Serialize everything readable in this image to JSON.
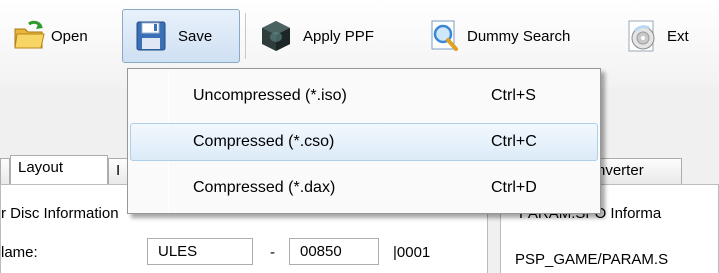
{
  "toolbar": {
    "open_label": "Open",
    "save_label": "Save",
    "apply_ppf_label": "Apply PPF",
    "dummy_search_label": "Dummy Search",
    "extract_label_partial": "Ext"
  },
  "save_menu": {
    "items": [
      {
        "label": "Uncompressed (*.iso)",
        "shortcut": "Ctrl+S"
      },
      {
        "label": "Compressed (*.cso)",
        "shortcut": "Ctrl+C"
      },
      {
        "label": "Compressed (*.dax)",
        "shortcut": "Ctrl+D"
      }
    ]
  },
  "tabs": {
    "layout": "Layout",
    "partial_hidden": "I",
    "converter_partial": "nverter"
  },
  "disc_info": {
    "group_title_partial": "r Disc Information",
    "name_label_partial": "lame:",
    "prefix_value": "ULES",
    "dash": "-",
    "number_value": "00850",
    "suffix_value": "|0001"
  },
  "param_sfo": {
    "group_title_partial": "PARAM.SFO Informa",
    "path_partial": "PSP_GAME/PARAM.S"
  },
  "colors": {
    "menu_hover_border": "#aecfe9",
    "pressed_button_fill": "#cfe0f3"
  }
}
